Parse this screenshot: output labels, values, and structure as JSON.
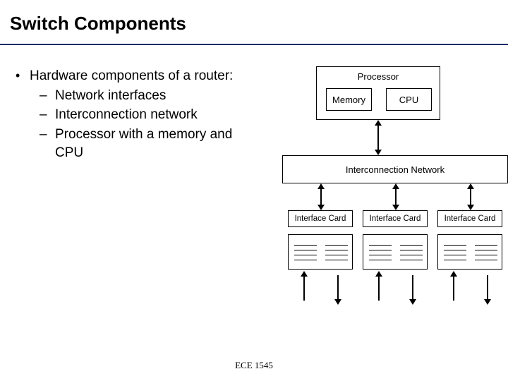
{
  "title": "Switch Components",
  "bullets": {
    "main": "Hardware components of a router:",
    "sub1": "Network interfaces",
    "sub2": "Interconnection network",
    "sub3": "Processor with a memory and CPU"
  },
  "diagram": {
    "processor": "Processor",
    "memory": "Memory",
    "cpu": "CPU",
    "interconnect": "Interconnection Network",
    "iface": "Interface Card"
  },
  "footer": "ECE 1545"
}
